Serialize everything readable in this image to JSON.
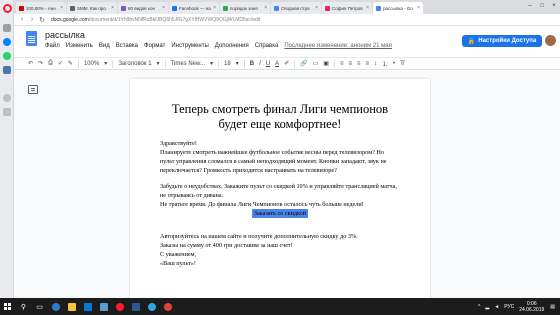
{
  "browser": {
    "tabs": [
      {
        "label": "100,00% - Анн",
        "color": "#cc0000"
      },
      {
        "label": "SMM. Как про",
        "color": "#5f6368"
      },
      {
        "label": "60 видов кон",
        "color": "#7e57c2"
      },
      {
        "label": "Facebook — на",
        "color": "#1877f2"
      },
      {
        "label": "порядок заня",
        "color": "#34a853"
      },
      {
        "label": "Сводная стра",
        "color": "#4285f4"
      },
      {
        "label": "София Петров",
        "color": "#e91e63"
      },
      {
        "label": "рассылка - Go",
        "color": "#4285f4",
        "active": true
      }
    ],
    "url_host": "docs.google.com",
    "url_path": "/document/d/1Yh9bvNNfRzBkfJBQ6h5JfG7gXYlHWVWQ9OGjWLMD5sc/edit"
  },
  "docs": {
    "title": "рассылка",
    "menu": [
      "Файл",
      "Изменить",
      "Вид",
      "Вставка",
      "Формат",
      "Инструменты",
      "Дополнения",
      "Справка"
    ],
    "last_edit": "Последнее изменение: аноним 21 мая",
    "share_label": "Настройки Доступа"
  },
  "toolbar": {
    "zoom": "100%",
    "style": "Заголовок 1",
    "font": "Times New...",
    "size": "18",
    "bold": "B",
    "italic": "I",
    "underline": "U",
    "text_color": "A"
  },
  "document": {
    "heading": "Теперь смотреть финал Лиги чемпионов будет еще комфортнее!",
    "greeting": "Здравствуйте!",
    "para1": "Планируете смотреть важнейшее футбольное событие весны перед телевизором? Но пульт управления сломался в самый неподходящий момент. Кнопки западают, звук не переключается? Громкость приходится настраивать на телевизоре?",
    "para2": "Забудьте о неудобствах. Закажите пульт со скидкой 10% и управляйте трансляцией матча, не отрываясь от дивана.",
    "para3": "Не тратьте время. До финала Лиги Чемпионов осталось чуть больше недели!",
    "cta": "Заказать со скидкой",
    "para4": "Авторизуйтесь на нашем сайте и получите дополнительную скидку до 3%.",
    "para5": "Заказы на сумму от 400 грн доставим за наш счет!",
    "sign1": "С уважением,",
    "sign2": "«Ваш пульт»!"
  },
  "taskbar": {
    "lang": "РУС",
    "time": "0:06",
    "date": "24.06.2019"
  },
  "colors": {
    "share": "#1a73e8",
    "highlight": "#4a86e8",
    "opera": "#ff1b2d"
  }
}
